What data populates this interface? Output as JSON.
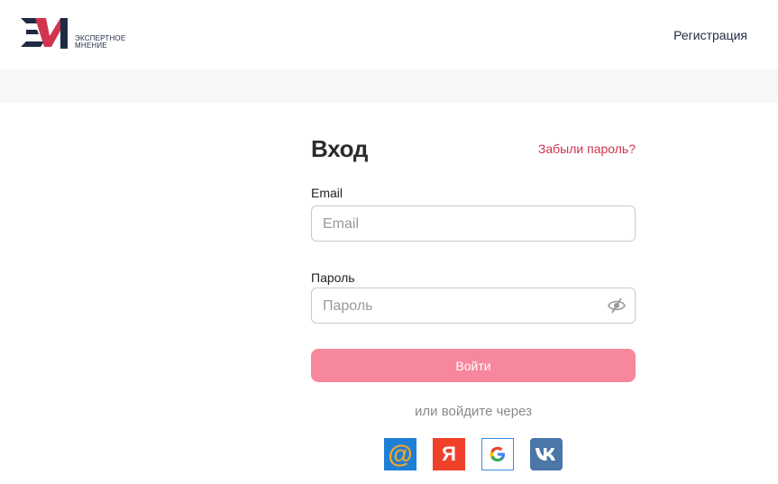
{
  "header": {
    "logo_text_line1": "ЭКСПЕРТНОЕ",
    "logo_text_line2": "МНЕНИЕ",
    "register_link": "Регистрация"
  },
  "form": {
    "title": "Вход",
    "forgot_link": "Забыли пароль?",
    "email_label": "Email",
    "email_placeholder": "Email",
    "password_label": "Пароль",
    "password_placeholder": "Пароль",
    "submit_label": "Войти",
    "alt_login_text": "или войдите через"
  },
  "social": [
    {
      "name": "mail-ru-icon",
      "glyph": "@"
    },
    {
      "name": "yandex-icon",
      "glyph": "Я"
    },
    {
      "name": "google-icon",
      "glyph": "G"
    },
    {
      "name": "vk-icon",
      "glyph": "vk"
    }
  ],
  "colors": {
    "brand_navy": "#1f2a44",
    "brand_red": "#d0344f",
    "submit_bg": "#f7879d",
    "band_bg": "#f6f7f9"
  }
}
